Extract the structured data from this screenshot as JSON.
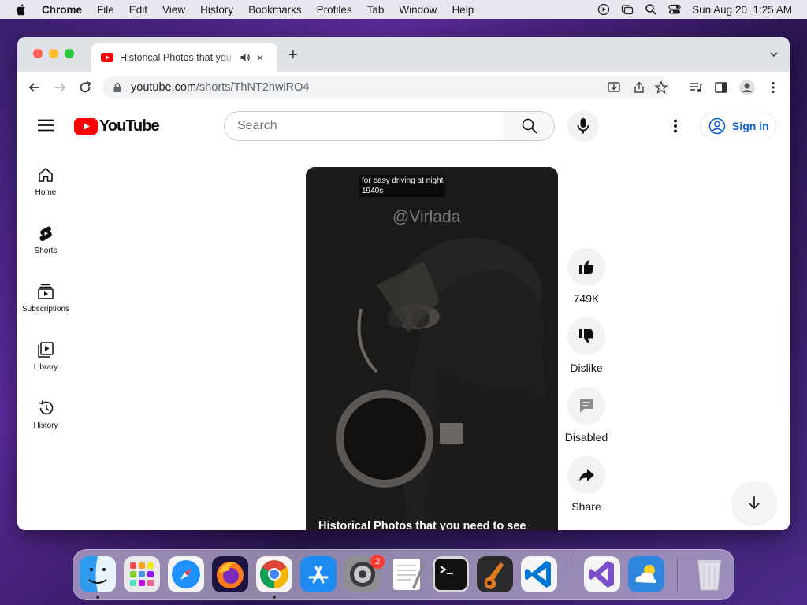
{
  "menubar": {
    "app_name": "Chrome",
    "items": [
      "File",
      "Edit",
      "View",
      "History",
      "Bookmarks",
      "Profiles",
      "Tab",
      "Window",
      "Help"
    ],
    "clock": "Sun Aug 20  1:25 AM"
  },
  "browser": {
    "tab_title": "Historical Photos that you need to see",
    "tab_close": "×",
    "new_tab": "+",
    "url_host": "youtube.com",
    "url_path": "/shorts/ThNT2hwiRO4"
  },
  "youtube": {
    "logo_text": "YouTube",
    "search_placeholder": "Search",
    "sign_in_label": "Sign in",
    "sidebar": [
      {
        "label": "Home",
        "icon": "home-icon"
      },
      {
        "label": "Shorts",
        "icon": "shorts-icon"
      },
      {
        "label": "Subscriptions",
        "icon": "subscriptions-icon"
      },
      {
        "label": "Library",
        "icon": "library-icon"
      },
      {
        "label": "History",
        "icon": "history-icon"
      }
    ],
    "short": {
      "overlay_line1": "for easy driving at night",
      "overlay_line2": "1940s",
      "watermark": "@Virlada",
      "title": "Historical Photos that you need to see"
    },
    "actions": {
      "like_count": "749K",
      "dislike_label": "Dislike",
      "comments_label": "Disabled",
      "share_label": "Share"
    }
  },
  "dock": {
    "settings_badge": "2"
  },
  "colors": {
    "youtube_red": "#ff0000",
    "link_blue": "#065fd4"
  }
}
